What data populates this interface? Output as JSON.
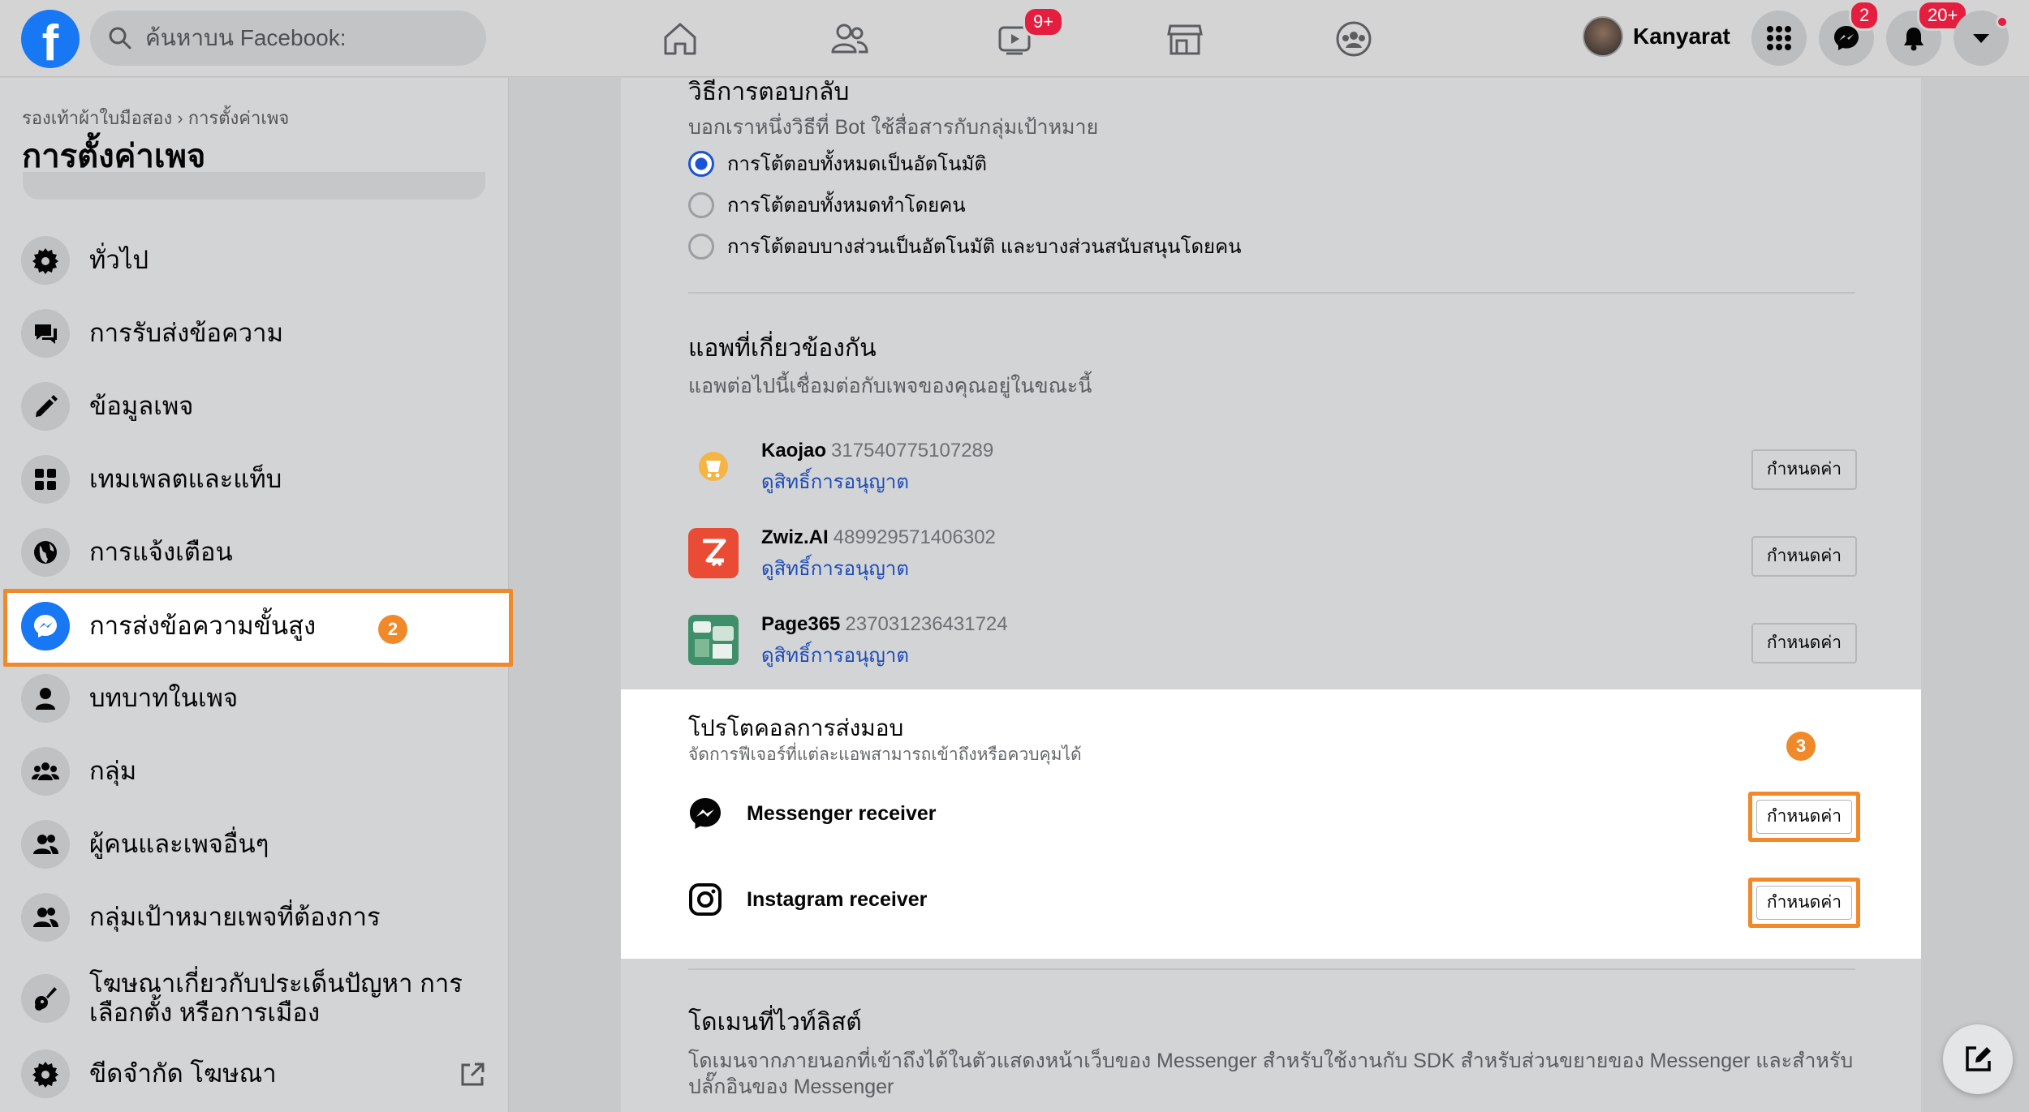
{
  "header": {
    "logo": "f",
    "search_placeholder": "ค้นหาบน Facebook:",
    "watch_badge": "9+",
    "messenger_badge": "2",
    "notifications_badge": "20+",
    "profile_name": "Kanyarat"
  },
  "sidebar": {
    "breadcrumb": "รองเท้าผ้าใบมือสอง › การตั้งค่าเพจ",
    "title": "การตั้งค่าเพจ",
    "step_badge": "2",
    "items": [
      {
        "label": "ทั่วไป",
        "icon": "gear-icon"
      },
      {
        "label": "การรับส่งข้อความ",
        "icon": "chat-icon"
      },
      {
        "label": "ข้อมูลเพจ",
        "icon": "pencil-icon"
      },
      {
        "label": "เทมเพลตและแท็บ",
        "icon": "grid-icon"
      },
      {
        "label": "การแจ้งเตือน",
        "icon": "globe-icon"
      },
      {
        "label": "การส่งข้อความขั้นสูง",
        "icon": "messenger-icon"
      },
      {
        "label": "บทบาทในเพจ",
        "icon": "person-icon"
      },
      {
        "label": "กลุ่ม",
        "icon": "group-icon"
      },
      {
        "label": "ผู้คนและเพจอื่นๆ",
        "icon": "people-icon"
      },
      {
        "label": "กลุ่มเป้าหมายเพจที่ต้องการ",
        "icon": "people-icon"
      },
      {
        "label": "โฆษณาเกี่ยวกับประเด็นปัญหา การเลือกตั้ง หรือการเมือง",
        "icon": "guitar-icon"
      },
      {
        "label": "ขีดจำกัด โฆษณา",
        "icon": "gear-icon"
      }
    ]
  },
  "main": {
    "response_heading": "วิธีการตอบกลับ",
    "response_sub": "บอกเราหนึ่งวิธีที่ Bot ใช้สื่อสารกับกลุ่มเป้าหมาย",
    "response_options": [
      "การโต้ตอบทั้งหมดเป็นอัตโนมัติ",
      "การโต้ตอบทั้งหมดทำโดยคน",
      "การโต้ตอบบางส่วนเป็นอัตโนมัติ และบางส่วนสนับสนุนโดยคน"
    ],
    "apps_heading": "แอพที่เกี่ยวข้องกัน",
    "apps_sub": "แอพต่อไปนี้เชื่อมต่อกับเพจของคุณอยู่ในขณะนี้",
    "apps": [
      {
        "name": "Kaojao",
        "id": "317540775107289",
        "link": "ดูสิทธิ์การอนุญาต",
        "button": "กำหนดค่า"
      },
      {
        "name": "Zwiz.AI",
        "id": "489929571406302",
        "link": "ดูสิทธิ์การอนุญาต",
        "button": "กำหนดค่า"
      },
      {
        "name": "Page365",
        "id": "237031236431724",
        "link": "ดูสิทธิ์การอนุญาต",
        "button": "กำหนดค่า"
      }
    ],
    "handover_heading": "โปรโตคอลการส่งมอบ",
    "handover_sub": "จัดการฟีเจอร์ที่แต่ละแอพสามารถเข้าถึงหรือควบคุมได้",
    "step_badge": "3",
    "receivers": [
      {
        "name": "Messenger receiver",
        "button": "กำหนดค่า"
      },
      {
        "name": "Instagram receiver",
        "button": "กำหนดค่า"
      }
    ],
    "whitelist_heading": "โดเมนที่ไวท์ลิสต์",
    "whitelist_sub": "โดเมนจากภายนอกที่เข้าถึงได้ในตัวแสดงหน้าเว็บของ Messenger สำหรับใช้งานกับ SDK สำหรับส่วนขยายของ Messenger และสำหรับปลั๊กอินของ Messenger"
  },
  "colors": {
    "facebook_blue": "#1877f2",
    "highlight_orange": "#f0892a",
    "link_blue": "#1b4bb8",
    "badge_red": "#e41e3f"
  }
}
